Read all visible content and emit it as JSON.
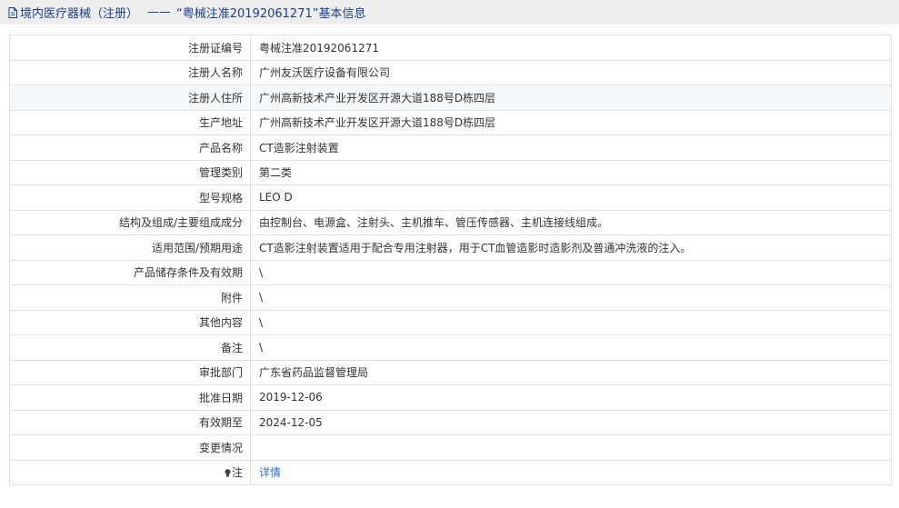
{
  "header": {
    "breadcrumb": "境内医疗器械（注册）",
    "separator": "——",
    "title": "“粤械注准20192061271”基本信息"
  },
  "rows": [
    {
      "label": "注册证编号",
      "value": "粤械注准20192061271"
    },
    {
      "label": "注册人名称",
      "value": "广州友沃医疗设备有限公司"
    },
    {
      "label": "注册人住所",
      "value": "广州高新技术产业开发区开源大道188号D栋四层"
    },
    {
      "label": "生产地址",
      "value": "广州高新技术产业开发区开源大道188号D栋四层"
    },
    {
      "label": "产品名称",
      "value": "CT造影注射装置"
    },
    {
      "label": "管理类别",
      "value": "第二类"
    },
    {
      "label": "型号规格",
      "value": "LEO D"
    },
    {
      "label": "结构及组成/主要组成成分",
      "value": "由控制台、电源盒、注射头、主机推车、管压传感器、主机连接线组成。"
    },
    {
      "label": "适用范围/预期用途",
      "value": "CT造影注射装置适用于配合专用注射器，用于CT血管造影时造影剂及普通冲洗液的注入。"
    },
    {
      "label": "产品储存条件及有效期",
      "value": "\\"
    },
    {
      "label": "附件",
      "value": "\\"
    },
    {
      "label": "其他内容",
      "value": "\\"
    },
    {
      "label": "备注",
      "value": "\\"
    },
    {
      "label": "审批部门",
      "value": "广东省药品监督管理局"
    },
    {
      "label": "批准日期",
      "value": "2019-12-06"
    },
    {
      "label": "有效期至",
      "value": "2024-12-05"
    },
    {
      "label": "变更情况",
      "value": ""
    }
  ],
  "note": {
    "icon": "lightbulb-icon",
    "label": "注",
    "link": "详情"
  },
  "colors": {
    "header_bg": "#eeeeee",
    "header_text": "#1d3f8c",
    "alt_row_bg": "#f5f9fc",
    "link": "#2a6fc9"
  }
}
